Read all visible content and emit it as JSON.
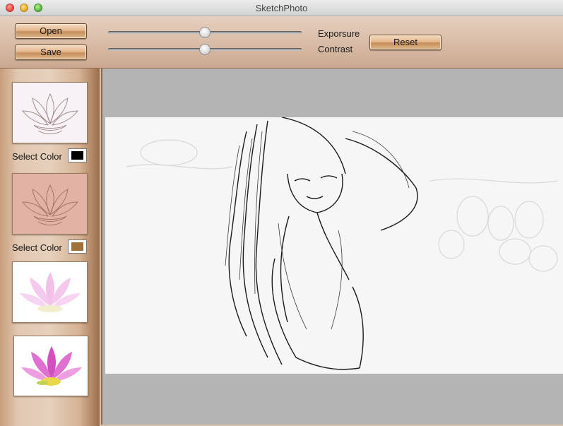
{
  "window": {
    "title": "SketchPhoto"
  },
  "toolbar": {
    "open_label": "Open",
    "save_label": "Save",
    "reset_label": "Reset",
    "exposure_label": "Exporsure",
    "contrast_label": "Contrast",
    "exposure_value": 0.5,
    "contrast_value": 0.5
  },
  "sidebar": {
    "select_color_label_1": "Select Color",
    "select_color_label_2": "Select Color",
    "swatch_1_color": "#000000",
    "swatch_2_color": "#a0703a",
    "thumbnails": [
      "pencil-sketch-white",
      "pencil-sketch-tinted",
      "lotus-soft",
      "lotus-color"
    ]
  },
  "canvas": {
    "background": "#b4b4b4"
  }
}
